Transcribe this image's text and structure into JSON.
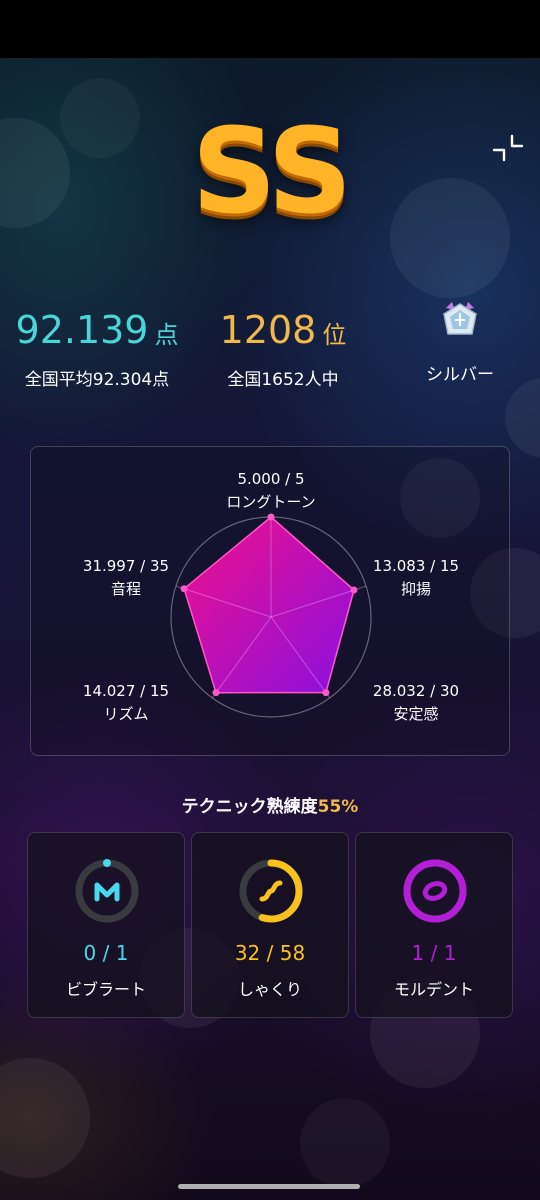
{
  "header": {
    "grade": "SS"
  },
  "summary": {
    "score_value": "92.139",
    "score_unit": "点",
    "average_label": "全国平均92.304点",
    "rank_value": "1208",
    "rank_unit": "位",
    "participants_label": "全国1652人中",
    "medal_label": "シルバー"
  },
  "radar": {
    "axes": [
      {
        "score": "5.000 / 5",
        "name": "ロングトーン"
      },
      {
        "score": "13.083 / 15",
        "name": "抑揚"
      },
      {
        "score": "28.032 / 30",
        "name": "安定感"
      },
      {
        "score": "14.027 / 15",
        "name": "リズム"
      },
      {
        "score": "31.997 / 35",
        "name": "音程"
      }
    ]
  },
  "chart_data": {
    "type": "radar",
    "categories": [
      "ロングトーン",
      "抑揚",
      "安定感",
      "リズム",
      "音程"
    ],
    "values": [
      5.0,
      13.083,
      28.032,
      14.027,
      31.997
    ],
    "max": [
      5,
      15,
      30,
      15,
      35
    ]
  },
  "technique": {
    "title_prefix": "テクニック熟練度",
    "percent": "55%",
    "items": [
      {
        "count": "0 / 1",
        "name": "ビブラート",
        "color": "#4ad8ec",
        "progress": 0.0
      },
      {
        "count": "32 /  58",
        "name": "しゃくり",
        "color": "#f8c21c",
        "progress": 0.55
      },
      {
        "count": "1 /  1",
        "name": "モルデント",
        "color": "#b21fd6",
        "progress": 1.0
      }
    ]
  },
  "colors": {
    "score": "#49d6d8",
    "rank": "#f0b94a",
    "radar_fill_start": "#f0108a",
    "radar_fill_end": "#8a10e0"
  }
}
